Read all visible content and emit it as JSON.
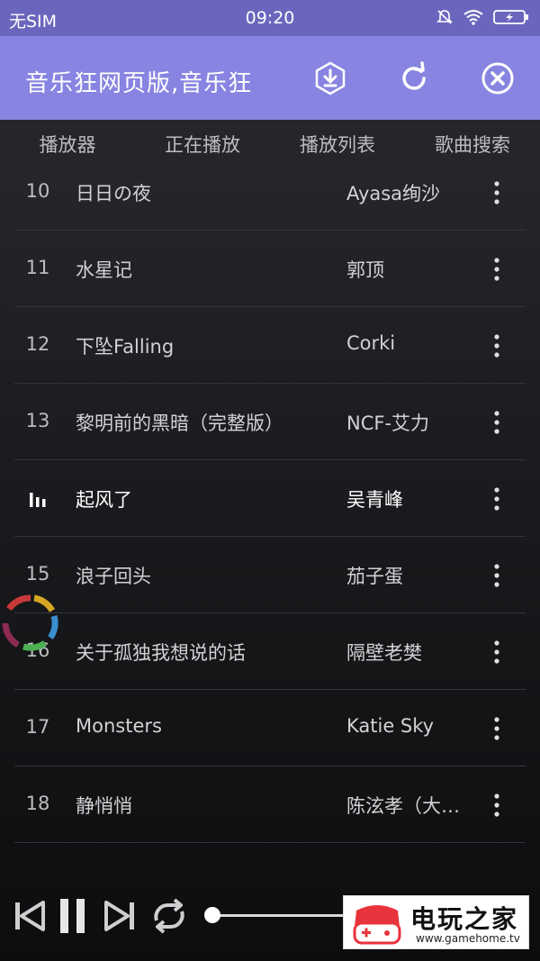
{
  "status_bar": {
    "carrier": "无SIM",
    "time": "09:20"
  },
  "app_bar": {
    "title": "音乐狂网页版,音乐狂",
    "buttons": [
      "download-icon",
      "refresh-icon",
      "close-icon"
    ]
  },
  "tabs": [
    {
      "label": "播放器"
    },
    {
      "label": "正在播放"
    },
    {
      "label": "播放列表"
    },
    {
      "label": "歌曲搜索"
    }
  ],
  "playlist": {
    "partial_top": {
      "num": "10",
      "name": "日日の夜",
      "artist": "Ayasa绚沙"
    },
    "rows": [
      {
        "num": "11",
        "name": "水星记",
        "artist": "郭顶",
        "active": false
      },
      {
        "num": "12",
        "name": "下坠Falling",
        "artist": "Corki",
        "active": false
      },
      {
        "num": "13",
        "name": "黎明前的黑暗（完整版）",
        "artist": "NCF-艾力",
        "active": false
      },
      {
        "num": "",
        "name": "起风了",
        "artist": "吴青峰",
        "active": true
      },
      {
        "num": "15",
        "name": "浪子回头",
        "artist": "茄子蛋",
        "active": false
      },
      {
        "num": "16",
        "name": "关于孤独我想说的话",
        "artist": "隔壁老樊",
        "active": false
      },
      {
        "num": "17",
        "name": "Monsters",
        "artist": "Katie Sky",
        "active": false
      },
      {
        "num": "18",
        "name": "静悄悄",
        "artist": "陈泫孝（大…",
        "active": false
      }
    ]
  },
  "player": {
    "controls": [
      "previous-icon",
      "pause-icon",
      "next-icon",
      "repeat-icon"
    ]
  },
  "watermark": {
    "text": "电玩之家",
    "url": "www.gamehome.tv"
  },
  "colors": {
    "status_bar": "#6b66bd",
    "app_bar": "#8884e1",
    "accent_red": "#e8333c"
  }
}
